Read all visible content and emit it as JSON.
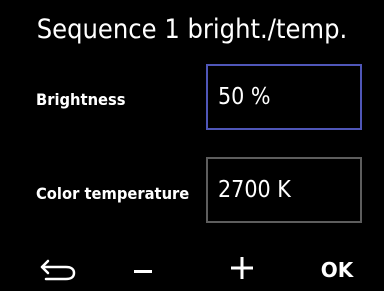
{
  "header": {
    "title": "Sequence 1 bright./temp."
  },
  "fields": {
    "brightness": {
      "label": "Brightness",
      "value": "50 %"
    },
    "color_temperature": {
      "label": "Color temperature",
      "value": "2700 K"
    }
  },
  "softkeys": {
    "back_icon": "return-arrow-icon",
    "minus_icon": "minus-icon",
    "plus_icon": "plus-icon",
    "ok_label": "OK"
  },
  "colors": {
    "background": "#000000",
    "text": "#ffffff",
    "focus_border": "#4f56b8",
    "field_border": "#5d5d5d"
  }
}
